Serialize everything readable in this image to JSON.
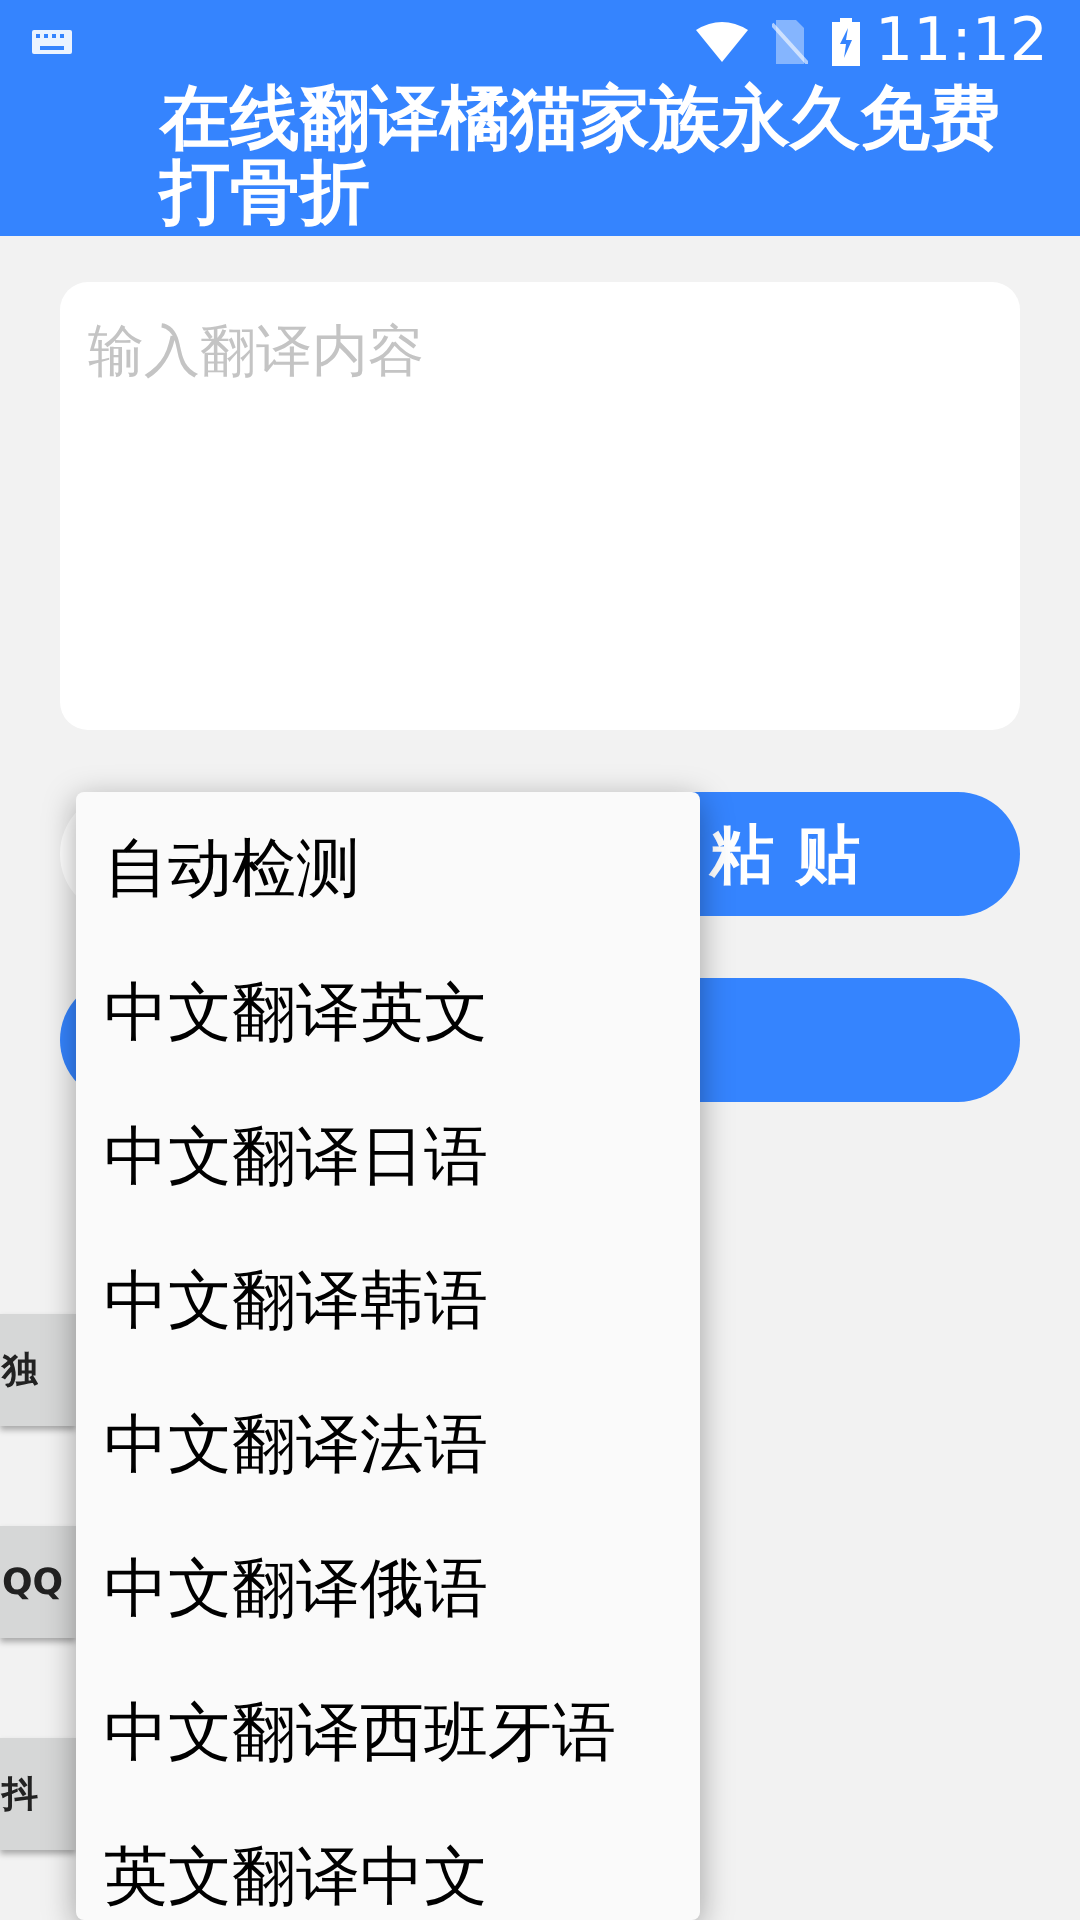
{
  "status_bar": {
    "time": "11:12"
  },
  "header": {
    "title": "在线翻译橘猫家族永久免费打骨折"
  },
  "input": {
    "placeholder": "输入翻译内容"
  },
  "paste_button": {
    "label": "粘 贴"
  },
  "side_buttons": [
    {
      "label": "独"
    },
    {
      "label": "QQ"
    },
    {
      "label": "抖"
    }
  ],
  "dropdown": {
    "items": [
      {
        "label": "自动检测"
      },
      {
        "label": "中文翻译英文"
      },
      {
        "label": "中文翻译日语"
      },
      {
        "label": "中文翻译韩语"
      },
      {
        "label": "中文翻译法语"
      },
      {
        "label": "中文翻译俄语"
      },
      {
        "label": "中文翻译西班牙语"
      },
      {
        "label": "英文翻译中文"
      }
    ]
  }
}
